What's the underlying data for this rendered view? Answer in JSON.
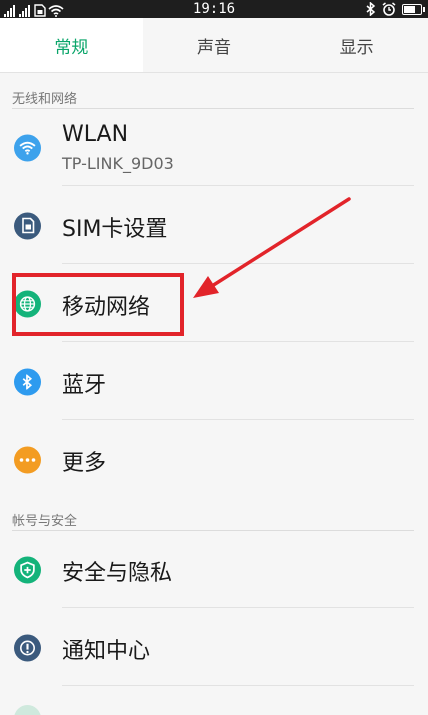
{
  "status_bar": {
    "time": "19:16",
    "signal1_label": "HD",
    "signal2_label": "HD",
    "battery_level": 0.8,
    "icons": [
      "signal-icon",
      "signal-icon",
      "sim-icon",
      "wifi-icon",
      "bluetooth-icon",
      "alarm-icon",
      "battery-icon"
    ]
  },
  "tabs": [
    {
      "label": "常规",
      "active": true
    },
    {
      "label": "声音",
      "active": false
    },
    {
      "label": "显示",
      "active": false
    }
  ],
  "sections": [
    {
      "header": "无线和网络",
      "items": [
        {
          "title": "WLAN",
          "subtitle": "TP-LINK_9D03",
          "icon": "wifi-icon",
          "color": "#3da2ec"
        },
        {
          "title": "SIM卡设置",
          "icon": "sim-card-icon",
          "color": "#3b5a7d"
        },
        {
          "title": "移动网络",
          "icon": "globe-icon",
          "color": "#14b37a"
        },
        {
          "title": "蓝牙",
          "icon": "bluetooth-icon",
          "color": "#2e9bef"
        },
        {
          "title": "更多",
          "icon": "more-icon",
          "color": "#f39c22"
        }
      ]
    },
    {
      "header": "帐号与安全",
      "items": [
        {
          "title": "安全与隐私",
          "icon": "shield-icon",
          "color": "#14b37a"
        },
        {
          "title": "通知中心",
          "icon": "notification-icon",
          "color": "#3b5a7d"
        }
      ]
    }
  ],
  "annotation": {
    "highlight_color": "#e2242a"
  }
}
